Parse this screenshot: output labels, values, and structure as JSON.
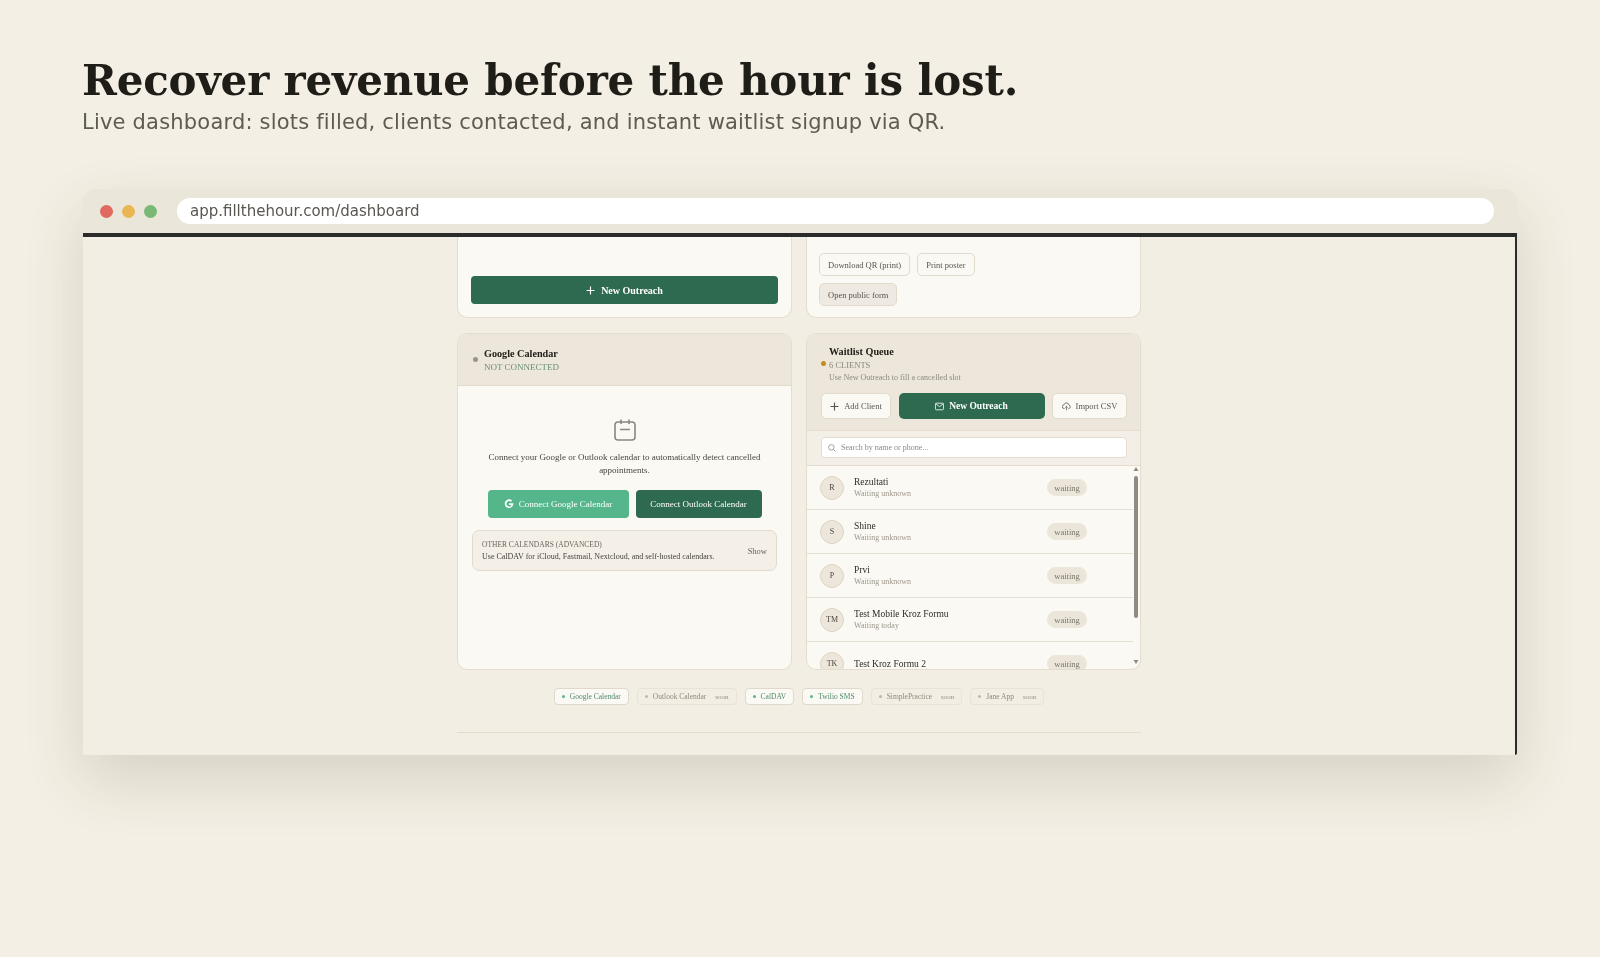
{
  "hero": {
    "title": "Recover revenue before the hour is lost.",
    "subtitle": "Live dashboard: slots filled, clients contacted, and instant waitlist signup via QR."
  },
  "browser": {
    "url": "app.fillthehour.com/dashboard"
  },
  "outreach_card": {
    "button": "New Outreach"
  },
  "qr_card": {
    "buttons": [
      {
        "label": "Download QR (print)",
        "kind": "outline"
      },
      {
        "label": "Print poster",
        "kind": "outline"
      },
      {
        "label": "Open public form",
        "kind": "filled"
      }
    ]
  },
  "calendar_card": {
    "title": "Google Calendar",
    "status": "NOT CONNECTED",
    "connected": false,
    "message": "Connect your Google or Outlook calendar to automatically detect cancelled appointments.",
    "buttons": [
      {
        "label": "Connect Google Calendar",
        "kind": "google"
      },
      {
        "label": "Connect Outlook Calendar",
        "kind": "outlook"
      }
    ],
    "advanced": {
      "title": "OTHER CALENDARS (ADVANCED)",
      "description": "Use CalDAV for iCloud, Fastmail, Nextcloud, and self-hosted calendars.",
      "toggle": "Show"
    }
  },
  "waitlist": {
    "title": "Waitlist Queue",
    "count": "6 CLIENTS",
    "hint": "Use New Outreach to fill a cancelled slot",
    "actions": [
      {
        "label": "Add Client",
        "kind": "add"
      },
      {
        "label": "New Outreach",
        "kind": "primary"
      },
      {
        "label": "Import CSV",
        "kind": "import"
      }
    ],
    "search": {
      "placeholder": "Search by name or phone..."
    },
    "clients": [
      {
        "initials": "R",
        "name": "Rezultati",
        "waiting": "Waiting unknown",
        "status": "waiting"
      },
      {
        "initials": "S",
        "name": "Shine",
        "waiting": "Waiting unknown",
        "status": "waiting"
      },
      {
        "initials": "P",
        "name": "Prvi",
        "waiting": "Waiting unknown",
        "status": "waiting"
      },
      {
        "initials": "TM",
        "name": "Test Mobile Kroz Formu",
        "waiting": "Waiting today",
        "status": "waiting"
      },
      {
        "initials": "TK",
        "name": "Test Kroz Formu 2",
        "status": "waiting"
      }
    ]
  },
  "integrations": [
    {
      "label": "Google Calendar",
      "available": true
    },
    {
      "label": "Outlook Calendar",
      "available": false,
      "note": "soon"
    },
    {
      "label": "CalDAV",
      "available": true
    },
    {
      "label": "Twilio SMS",
      "available": true
    },
    {
      "label": "SimplePractice",
      "available": false,
      "note": "soon"
    },
    {
      "label": "Jane App",
      "available": false,
      "note": "soon"
    }
  ]
}
